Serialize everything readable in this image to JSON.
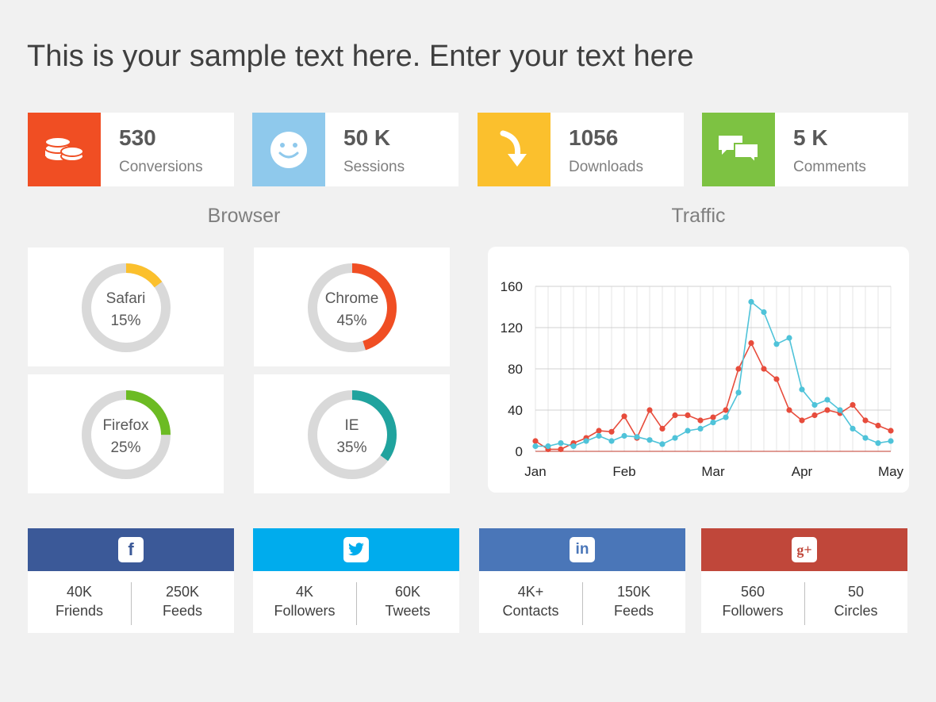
{
  "title": "This is your sample text here. Enter your text here",
  "kpis": [
    {
      "value": "530",
      "label": "Conversions",
      "color": "#f04e23",
      "icon": "coins-icon"
    },
    {
      "value": "50 K",
      "label": "Sessions",
      "color": "#8fc9ec",
      "icon": "smiley-icon"
    },
    {
      "value": "1056",
      "label": "Downloads",
      "color": "#fbc02d",
      "icon": "arrow-down-icon"
    },
    {
      "value": "5 K",
      "label": "Comments",
      "color": "#7dc242",
      "icon": "chat-bubbles-icon"
    }
  ],
  "browser": {
    "title": "Browser",
    "items": [
      {
        "name": "Safari",
        "value": "15%",
        "fraction": 0.15,
        "color": "#fbc02d"
      },
      {
        "name": "Chrome",
        "value": "45%",
        "fraction": 0.45,
        "color": "#f04e23"
      },
      {
        "name": "Firefox",
        "value": "25%",
        "fraction": 0.25,
        "color": "#6cbb23"
      },
      {
        "name": "IE",
        "value": "35%",
        "fraction": 0.35,
        "color": "#20a39e"
      }
    ]
  },
  "traffic": {
    "title": "Traffic"
  },
  "chart_data": {
    "type": "line",
    "title": "Traffic",
    "x_tick_labels": [
      "Jan",
      "Feb",
      "Mar",
      "Apr",
      "May"
    ],
    "y_ticks": [
      0,
      40,
      80,
      120,
      160
    ],
    "ylim": [
      0,
      160
    ],
    "grid": true,
    "series": [
      {
        "color": "#e74c3c",
        "values": [
          10,
          2,
          2,
          8,
          13,
          20,
          19,
          34,
          13,
          40,
          22,
          35,
          35,
          30,
          33,
          40,
          80,
          105,
          80,
          70,
          40,
          30,
          35,
          40,
          37,
          45,
          30,
          25,
          20
        ]
      },
      {
        "color": "#4fc3d9",
        "values": [
          5,
          5,
          8,
          5,
          10,
          15,
          10,
          15,
          14,
          11,
          7,
          13,
          20,
          22,
          28,
          33,
          57,
          145,
          135,
          104,
          110,
          60,
          45,
          50,
          40,
          22,
          13,
          8,
          10
        ]
      }
    ]
  },
  "social": [
    {
      "network": "Facebook",
      "icon": "facebook-icon",
      "glyph": "f",
      "color": "#3b5998",
      "left_value": "40K",
      "left_label": "Friends",
      "right_value": "250K",
      "right_label": "Feeds"
    },
    {
      "network": "Twitter",
      "icon": "twitter-icon",
      "glyph": "t",
      "color": "#00aced",
      "left_value": "4K",
      "left_label": "Followers",
      "right_value": "60K",
      "right_label": "Tweets"
    },
    {
      "network": "LinkedIn",
      "icon": "linkedin-icon",
      "glyph": "in",
      "color": "#4a76b8",
      "left_value": "4K+",
      "left_label": "Contacts",
      "right_value": "150K",
      "right_label": "Feeds"
    },
    {
      "network": "Google+",
      "icon": "google-plus-icon",
      "glyph": "g+",
      "color": "#c0473a",
      "left_value": "560",
      "left_label": "Followers",
      "right_value": "50",
      "right_label": "Circles"
    }
  ]
}
